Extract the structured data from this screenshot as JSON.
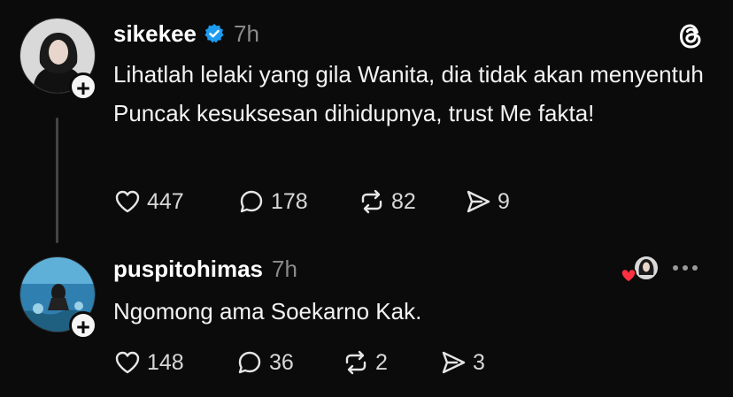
{
  "posts": [
    {
      "username": "sikekee",
      "verified": true,
      "time": "7h",
      "text": "Lihatlah lelaki yang gila Wanita, dia tidak akan menyentuh Puncak kesuksesan dihidupnya, trust Me fakta!",
      "likes": "447",
      "replies": "178",
      "reposts": "82",
      "shares": "9"
    },
    {
      "username": "puspitohimas",
      "verified": false,
      "time": "7h",
      "text": "Ngomong ama Soekarno Kak.",
      "likes": "148",
      "replies": "36",
      "reposts": "2",
      "shares": "3"
    }
  ],
  "icons": {
    "follow": "plus-icon",
    "like": "heart-icon",
    "reply": "comment-icon",
    "repost": "repost-icon",
    "share": "send-icon",
    "app": "threads-logo-icon",
    "menu": "more-icon"
  },
  "colors": {
    "background": "#0b0b0b",
    "text": "#f3f3f3",
    "muted": "#8a8a8a",
    "verified": "#1d9bf0",
    "liked_heart": "#ff3040"
  }
}
